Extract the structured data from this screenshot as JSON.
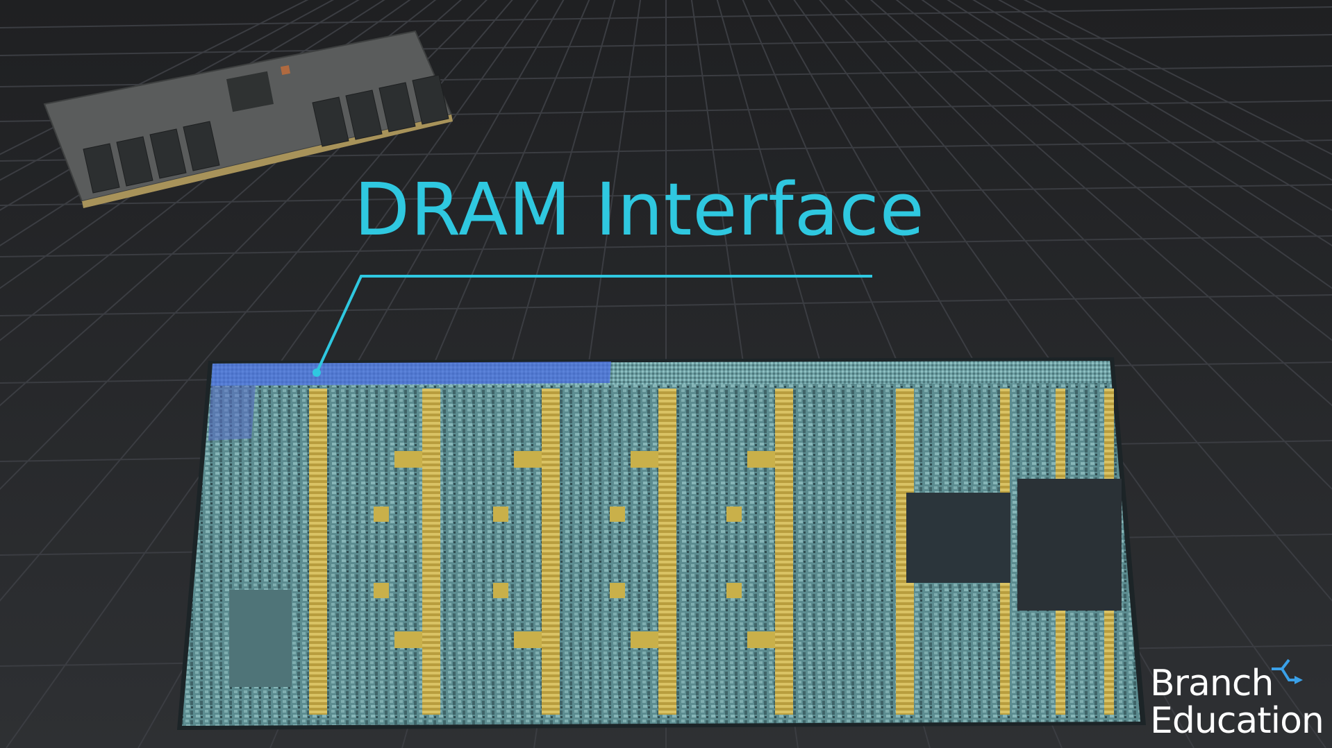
{
  "title": "DRAM Interface",
  "logo": {
    "line1": "Branch",
    "line2": "Education"
  },
  "colors": {
    "background": "#2a2b2e",
    "grid": "#3a3c40",
    "accent": "#2fc8e0",
    "die": "#5e8f93",
    "gold": "#c9b04a",
    "highlight": "#4a6ee0"
  }
}
